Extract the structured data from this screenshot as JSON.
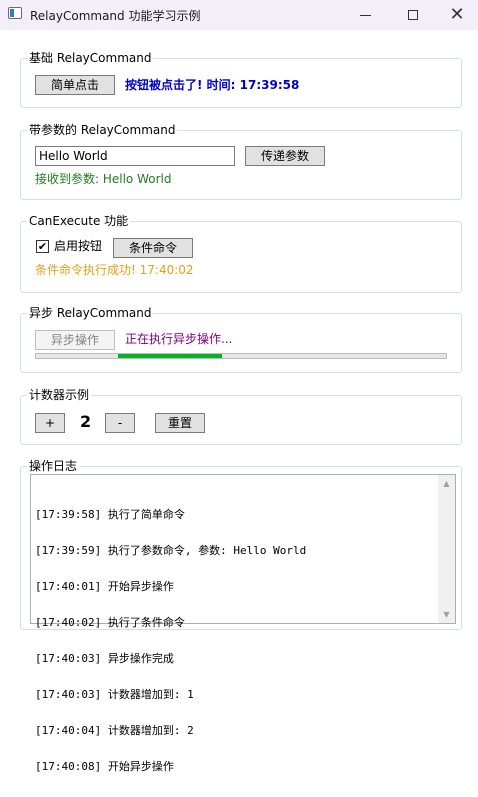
{
  "window": {
    "title": "RelayCommand 功能学习示例",
    "icon": "window-app-icon",
    "controls": [
      "minimize-icon",
      "maximize-icon",
      "close-icon"
    ]
  },
  "basic": {
    "header": "基础 RelayCommand",
    "button_label": "简单点击",
    "status": "按钮被点击了! 时间: 17:39:58",
    "status_color": "#0000cd"
  },
  "param": {
    "header": "带参数的 RelayCommand",
    "input_value": "Hello World",
    "button_label": "传递参数",
    "status": "接收到参数: Hello World",
    "status_color": "#1e7d1e"
  },
  "canexecute": {
    "header": "CanExecute 功能",
    "checkbox_label": "启用按钮",
    "checked": true,
    "button_label": "条件命令",
    "status": "条件命令执行成功! 17:40:02",
    "status_color": "#e6a019"
  },
  "async": {
    "header": "异步 RelayCommand",
    "button_label": "异步操作",
    "status": "正在执行异步操作...",
    "status_color": "#800080",
    "progress_color": "#06b025"
  },
  "counter": {
    "header": "计数器示例",
    "plus_label": "+",
    "value": "2",
    "minus_label": "-",
    "reset_label": "重置"
  },
  "log": {
    "header": "操作日志",
    "lines": [
      "[17:39:58] 执行了简单命令",
      "[17:39:59] 执行了参数命令, 参数: Hello World",
      "[17:40:01] 开始异步操作",
      "[17:40:02] 执行了条件命令",
      "[17:40:03] 异步操作完成",
      "[17:40:03] 计数器增加到: 1",
      "[17:40:04] 计数器增加到: 2",
      "[17:40:08] 开始异步操作"
    ]
  }
}
